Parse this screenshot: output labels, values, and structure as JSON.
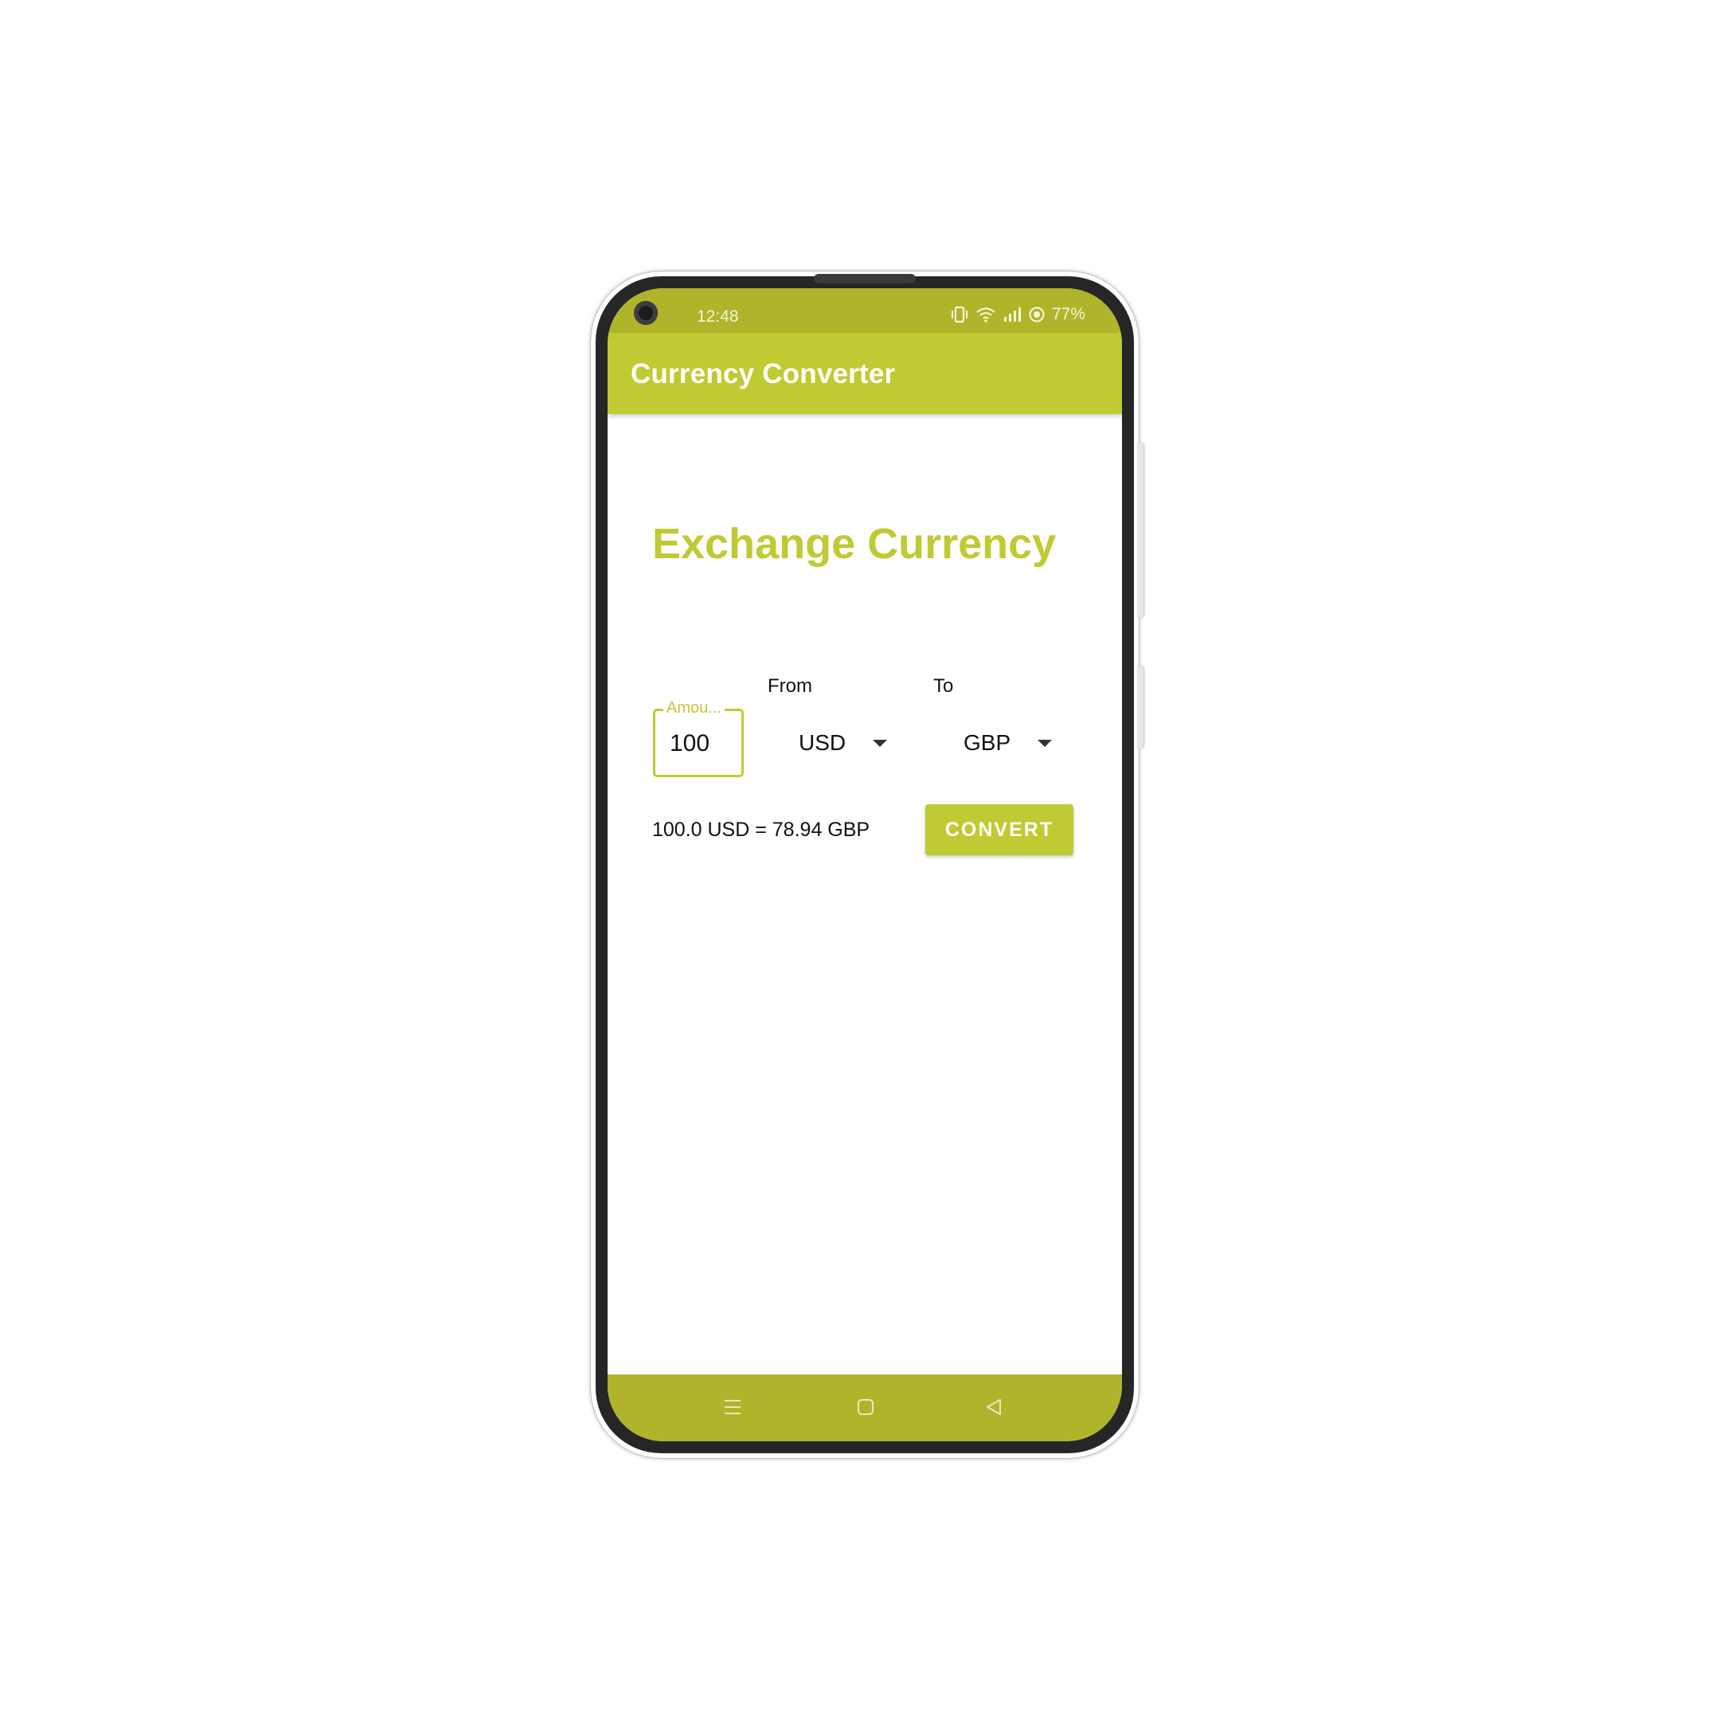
{
  "status_bar": {
    "time": "12:48",
    "battery": "77%",
    "icons": [
      "vibrate-icon",
      "wifi-icon",
      "signal-icon",
      "data-saver-icon"
    ]
  },
  "app_bar": {
    "title": "Currency Converter"
  },
  "main": {
    "heading": "Exchange Currency",
    "amount_field": {
      "label": "Amou...",
      "value": "100"
    },
    "from": {
      "label": "From",
      "selected": "USD"
    },
    "to": {
      "label": "To",
      "selected": "GBP"
    },
    "result": "100.0 USD = 78.94 GBP",
    "convert_label": "CONVERT"
  },
  "nav_bar": {
    "icons": [
      "recents-icon",
      "home-icon",
      "back-icon"
    ]
  },
  "colors": {
    "primary": "#c0ca33",
    "primary_dark": "#afb42b",
    "text": "#111111"
  }
}
